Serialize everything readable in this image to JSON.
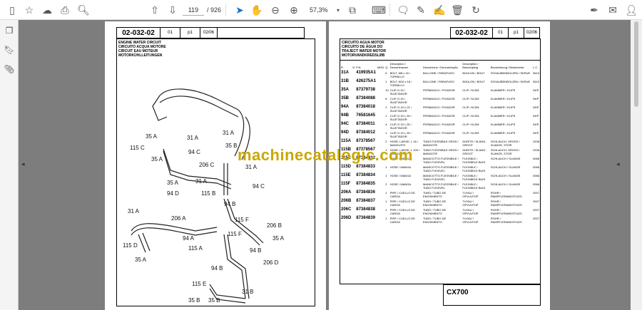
{
  "toolbar": {
    "current_page": "119",
    "page_count": "/ 926",
    "zoom": "57,3%"
  },
  "left_page": {
    "header": {
      "code": "02-032-02",
      "rev": "01",
      "part": "p1",
      "date": "02/06"
    },
    "title_lines": [
      "ENGINE WATER CIRCUIT",
      "CIRCUITO ACQUA MOTORE",
      "CIRCUIT EAU MOTEUR",
      "MOTORKÜHLLEITUNGEN"
    ],
    "diagram_labels": [
      "35 A",
      "115 C",
      "35 A",
      "31 A",
      "31 A",
      "35 B",
      "94 C",
      "206 C",
      "115 B",
      "31 A",
      "94 C",
      "35 A",
      "31 A",
      "94 D",
      "31 A",
      "206 A",
      "94 A",
      "115 A",
      "115 D",
      "35 A",
      "94 B",
      "115 F",
      "206 B",
      "35 A",
      "115 F",
      "94 B",
      "206 D",
      "94 B",
      "115 E",
      "35 B",
      "35 B",
      "31 B"
    ]
  },
  "right_page": {
    "header": {
      "code": "02-032-02",
      "rev": "01",
      "part": "p1",
      "date": "02/06"
    },
    "title_lines": [
      "CIRCUITO AGUA MOTOR",
      "CIRCUITO DE ÁGUA DO",
      "TRAJECT WATER MOTOR",
      "MOTORVANDKREDSLØB"
    ],
    "columns": [
      "R",
      "N",
      "P.N.",
      "MOD",
      "Q",
      "Description / Denominacion",
      "Descrizione / Denominação",
      "Description / Beschrijving",
      "Bezeichnung / Beskrivelse",
      "L.C."
    ],
    "rows": [
      {
        "ref": "31A",
        "pn": "419935A1",
        "q": "6",
        "d1": "BOLT, M8 x 16 / TORNILLO",
        "d2": "BULLONE / PARAFUSO",
        "d3": "BOULON / BOUT",
        "d4": "SCHAUBENBOLZEN / SKRUE",
        "lc": "0610"
      },
      {
        "ref": "31B",
        "pn": "426275A1",
        "q": "1",
        "d1": "BOLT, M10 x 16 / TORNILLO",
        "d2": "BULLONE / PARAFUSO",
        "d3": "BOULON / BOUT",
        "d4": "SCHAUBENBOLZEN / SKRUE",
        "lc": "0610"
      },
      {
        "ref": "35A",
        "pn": "87379738",
        "q": "10",
        "d1": "CLIP, D 20 / SUJETADOR",
        "d2": "FERMAGLIO / FIXADOR",
        "d3": "CLIP / KLEM",
        "d4": "KLAMMER / KLIPS",
        "lc": "04IP"
      },
      {
        "ref": "35B",
        "pn": "87384088",
        "q": "8",
        "d1": "CLIP, D 20 / SUJETADOR",
        "d2": "FERMAGLIO / FIXADOR",
        "d3": "CLIP / KLEM",
        "d4": "KLAMMER / KLIPS",
        "lc": "04IP"
      },
      {
        "ref": "94A",
        "pn": "87384018",
        "q": "2",
        "d1": "CLIP, D 19.1-21 / SUJETADOR",
        "d2": "FERMAGLIO / FIXADOR",
        "d3": "CLIP / KLEM",
        "d4": "KLAMMER / KLIPS",
        "lc": "04IP"
      },
      {
        "ref": "94B",
        "pn": "76581645",
        "q": "1",
        "d1": "CLIP, D 19 L 25 / SUJETADOR",
        "d2": "FERMAGLIO / FIXADOR",
        "d3": "CLIP / KLEM",
        "d4": "KLAMMER / KLIPS",
        "lc": "04IP"
      },
      {
        "ref": "94C",
        "pn": "87384011",
        "q": "4",
        "d1": "CLIP, D 19 L 25 / SUJETADOR",
        "d2": "FERMAGLIO / FIXADOR",
        "d3": "CLIP / KLEM",
        "d4": "KLAMMER / KLIPS",
        "lc": "04IP"
      },
      {
        "ref": "94D",
        "pn": "87384012",
        "q": "1",
        "d1": "CLIP, D 19 L 25 / SUJETADOR",
        "d2": "FERMAGLIO / FIXADOR",
        "d3": "CLIP / KLEM",
        "d4": "KLAMMER / KLIPS",
        "lc": "04IP"
      },
      {
        "ref": "115A",
        "pn": "87378567",
        "q": "2",
        "d1": "HOSE, LARGE, L 16 / MANGUITO",
        "d2": "TUBO FLESSIBILE GROS / MANGOTE",
        "d3": "DURITE / SLANG, GROOT",
        "d4": "SCHLAUCH, GROSS / SLANGE, STOR",
        "lc": "2206"
      },
      {
        "ref": "115B",
        "pn": "87378567",
        "q": "1",
        "d1": "HOSE, LARGE, L 100 / MANGUITO",
        "d2": "TUBO FLESSIBILE GROS / MANGOTE",
        "d3": "DURITE / SLANG, GROOT",
        "d4": "SCHLAUCH, GROSS / SLANGE, STOR",
        "lc": "2206"
      },
      {
        "ref": "115C",
        "pn": "87384832",
        "q": "1",
        "d1": "HOSE / MANGA",
        "d2": "MANICOTTO FLESSIBILE / TUBO FLEXIVEL",
        "d3": "FLEXIBLE / FLEXIBELE BUIS",
        "d4": "SCHLAUCH / SLANGE",
        "lc": "0066"
      },
      {
        "ref": "115D",
        "pn": "87384833",
        "q": "1",
        "d1": "HOSE / MANGA",
        "d2": "MANICOTTO FLESSIBILE / TUBO FLEXIVEL",
        "d3": "FLEXIBLE / FLEXIBELE BUIS",
        "d4": "SCHLAUCH / SLANGE",
        "lc": "0066"
      },
      {
        "ref": "115E",
        "pn": "87384834",
        "q": "1",
        "d1": "HOSE / MANGA",
        "d2": "MANICOTTO FLESSIBILE / TUBO FLEXIVEL",
        "d3": "FLEXIBLE / FLEXIBELE BUIS",
        "d4": "SCHLAUCH / SLANGE",
        "lc": "0066"
      },
      {
        "ref": "115F",
        "pn": "87384835",
        "q": "2",
        "d1": "HOSE / MANGA",
        "d2": "MANICOTTO FLESSIBILE / TUBO FLEXIVEL",
        "d3": "FLEXIBLE / FLEXIBELE BUIS",
        "d4": "SCHLAUCH / SLANGE",
        "lc": "0066"
      },
      {
        "ref": "206A",
        "pn": "87384836",
        "q": "1",
        "d1": "PIPE / CUELLO DE CARGA",
        "d2": "TUBO / TUBO DE ENCHIMENTO",
        "d3": "TUYAU / OPVULPIJP",
        "d4": "ROHR / RAMPFLERANDSTUDS",
        "lc": "2007"
      },
      {
        "ref": "206B",
        "pn": "87384837",
        "q": "1",
        "d1": "PIPE / CUELLO DE CARGA",
        "d2": "TUBO / TUBO DE ENCHIMENTO",
        "d3": "TUYAU / OPVULPIJP",
        "d4": "ROHR / RAMPFLERANDSTUDS",
        "lc": "2007"
      },
      {
        "ref": "206C",
        "pn": "87384838",
        "q": "1",
        "d1": "PIPE / CUELLO DE CARGA",
        "d2": "TUBO / TUBO DE ENCHIMENTO",
        "d3": "TUYAU / OPVULPIJP",
        "d4": "ROHR / RAMPFLERANDSTUDS",
        "lc": "2007"
      },
      {
        "ref": "206D",
        "pn": "87384839",
        "q": "1",
        "d1": "PIPE / CUELLO DE CARGA",
        "d2": "TUBO / TUBO DE ENCHIMENTO",
        "d3": "TUYAU / OPVULPIJP",
        "d4": "ROHR / RAMPFLERANDSTUDS",
        "lc": "2007"
      }
    ],
    "model": "CX700"
  },
  "watermark": "machinecatalogic.com"
}
